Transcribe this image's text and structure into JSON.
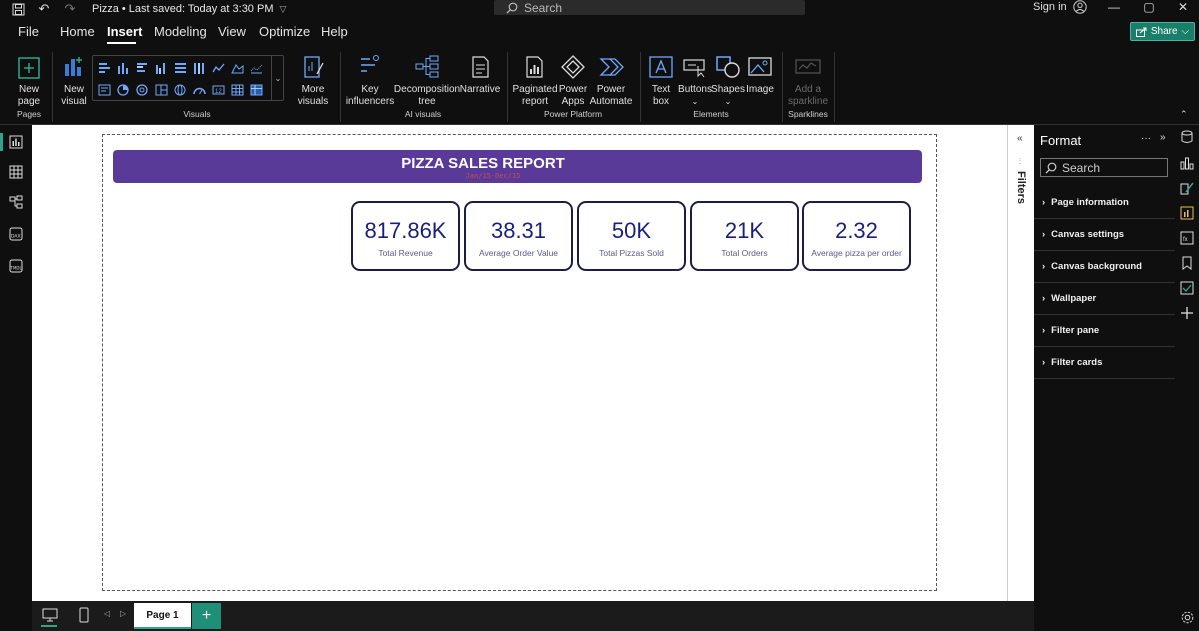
{
  "titlebar": {
    "doc_name": "Pizza",
    "separator": "•",
    "save_status": "Last saved: Today at 3:30 PM",
    "search_placeholder": "Search",
    "signin": "Sign in"
  },
  "menu": {
    "tabs": [
      "File",
      "Home",
      "Insert",
      "Modeling",
      "View",
      "Optimize",
      "Help"
    ],
    "active_tab": "Insert",
    "share_label": "Share"
  },
  "ribbon": {
    "new_page": "New\npage",
    "new_visual": "New\nvisual",
    "more_visuals": "More\nvisuals",
    "key_influencers": "Key\ninfluencers",
    "decomposition_tree": "Decomposition\ntree",
    "narrative": "Narrative",
    "paginated_report": "Paginated\nreport",
    "power_apps": "Power\nApps",
    "power_automate": "Power\nAutomate",
    "text_box": "Text\nbox",
    "buttons": "Buttons",
    "shapes": "Shapes",
    "image": "Image",
    "add_sparkline": "Add a\nsparkline",
    "groups": {
      "pages": "Pages",
      "visuals": "Visuals",
      "ai_visuals": "AI visuals",
      "power_platform": "Power Platform",
      "elements": "Elements",
      "sparklines": "Sparklines"
    }
  },
  "report": {
    "title": "PIZZA SALES REPORT",
    "subtitle": "Jan/15-Dec/15",
    "cards": [
      {
        "value": "817.86K",
        "label": "Total Revenue"
      },
      {
        "value": "38.31",
        "label": "Average Order Value"
      },
      {
        "value": "50K",
        "label": "Total Pizzas Sold"
      },
      {
        "value": "21K",
        "label": "Total Orders"
      },
      {
        "value": "2.32",
        "label": "Average pizza per order"
      }
    ]
  },
  "filters": {
    "label": "Filters"
  },
  "format_pane": {
    "title": "Format",
    "search_placeholder": "Search",
    "sections": [
      "Page information",
      "Canvas settings",
      "Canvas background",
      "Wallpaper",
      "Filter pane",
      "Filter cards"
    ]
  },
  "bottom": {
    "page_tab": "Page 1",
    "add_page": "+"
  },
  "colors": {
    "accent": "#1f8f77",
    "banner": "#5a3a99",
    "kpi_value": "#1b1f7a"
  }
}
